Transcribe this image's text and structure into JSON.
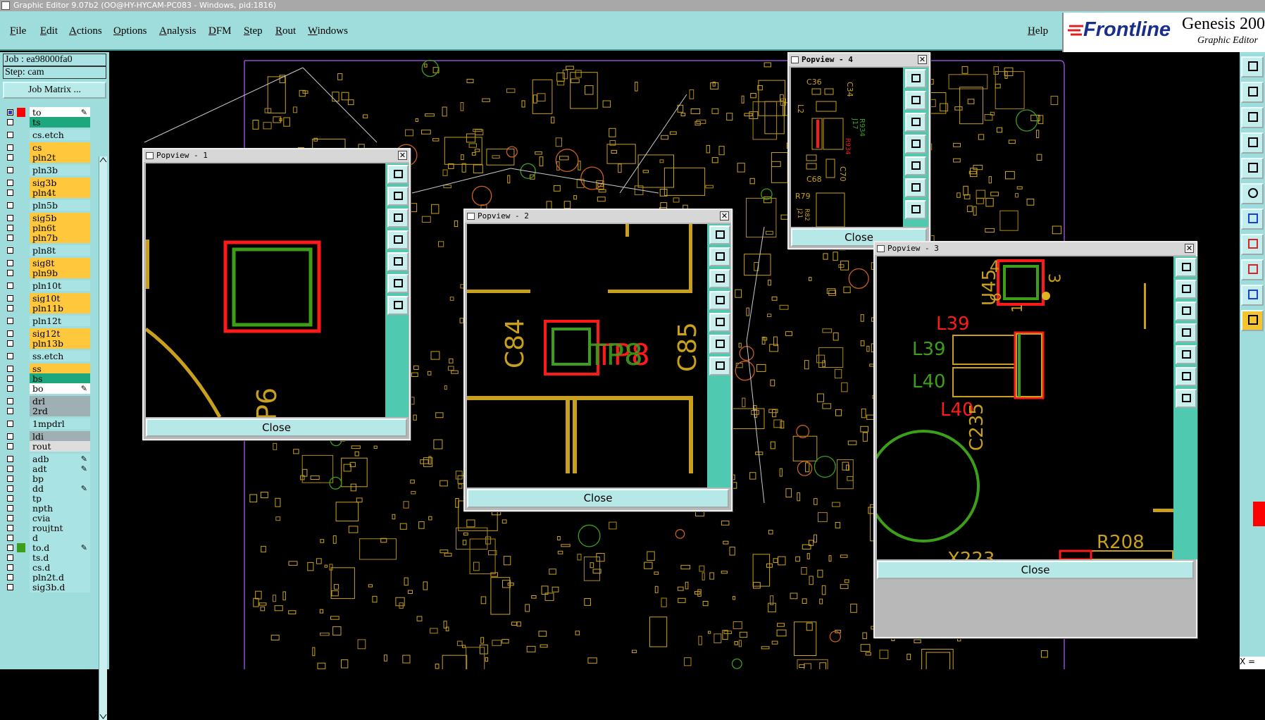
{
  "window": {
    "title": "Graphic Editor 9.07b2 (OO@HY-HYCAM-PC083 - Windows, pid:1816)"
  },
  "menu": {
    "items": [
      "File",
      "Edit",
      "Actions",
      "Options",
      "Analysis",
      "DFM",
      "Step",
      "Rout",
      "Windows"
    ],
    "help": "Help"
  },
  "brand": {
    "logo": "Frontline",
    "product": "Genesis 200",
    "subtitle": "Graphic Editor"
  },
  "job": {
    "job_label": "Job : ea98000fa0",
    "step_label": "Step: cam",
    "matrix_button": "Job Matrix ..."
  },
  "colors": {
    "cyan_ui": "#9fdcdc",
    "layer_yellow": "#ffc83c",
    "layer_teal": "#1ca87c",
    "layer_grey": "#9fb0b5",
    "copper": "#c8a01e",
    "green": "#3d9e1a",
    "red": "#ff1a1a"
  },
  "layers": [
    {
      "name": "to",
      "color": "#ffffff",
      "swatch": "#ff0000",
      "checked": true,
      "edit": true
    },
    {
      "name": "ts",
      "color": "#1ca87c",
      "swatch": "",
      "checked": false,
      "edit": false
    },
    {
      "name": "cs.etch",
      "color": "#a9e3e3",
      "swatch": "",
      "checked": false,
      "edit": false,
      "gap": true
    },
    {
      "name": "cs",
      "color": "#ffc83c",
      "swatch": "",
      "checked": false,
      "edit": false,
      "gap": true
    },
    {
      "name": "pln2t",
      "color": "#ffc83c",
      "swatch": "",
      "checked": false,
      "edit": false
    },
    {
      "name": "pln3b",
      "color": "#a9e3e3",
      "swatch": "",
      "checked": false,
      "edit": false,
      "gap": true
    },
    {
      "name": "sig3b",
      "color": "#ffc83c",
      "swatch": "",
      "checked": false,
      "edit": false,
      "gap": true
    },
    {
      "name": "pln4t",
      "color": "#ffc83c",
      "swatch": "",
      "checked": false,
      "edit": false
    },
    {
      "name": "pln5b",
      "color": "#a9e3e3",
      "swatch": "",
      "checked": false,
      "edit": false,
      "gap": true
    },
    {
      "name": "sig5b",
      "color": "#ffc83c",
      "swatch": "",
      "checked": false,
      "edit": false,
      "gap": true
    },
    {
      "name": "pln6t",
      "color": "#ffc83c",
      "swatch": "",
      "checked": false,
      "edit": false
    },
    {
      "name": "pln7b",
      "color": "#ffc83c",
      "swatch": "",
      "checked": false,
      "edit": false
    },
    {
      "name": "pln8t",
      "color": "#a9e3e3",
      "swatch": "",
      "checked": false,
      "edit": false,
      "gap": true
    },
    {
      "name": "sig8t",
      "color": "#ffc83c",
      "swatch": "",
      "checked": false,
      "edit": false,
      "gap": true
    },
    {
      "name": "pln9b",
      "color": "#ffc83c",
      "swatch": "",
      "checked": false,
      "edit": false
    },
    {
      "name": "pln10t",
      "color": "#a9e3e3",
      "swatch": "",
      "checked": false,
      "edit": false,
      "gap": true
    },
    {
      "name": "sig10t",
      "color": "#ffc83c",
      "swatch": "",
      "checked": false,
      "edit": false,
      "gap": true
    },
    {
      "name": "pln11b",
      "color": "#ffc83c",
      "swatch": "",
      "checked": false,
      "edit": false
    },
    {
      "name": "pln12t",
      "color": "#a9e3e3",
      "swatch": "",
      "checked": false,
      "edit": false,
      "gap": true
    },
    {
      "name": "sig12t",
      "color": "#ffc83c",
      "swatch": "",
      "checked": false,
      "edit": false,
      "gap": true
    },
    {
      "name": "pln13b",
      "color": "#ffc83c",
      "swatch": "",
      "checked": false,
      "edit": false
    },
    {
      "name": "ss.etch",
      "color": "#a9e3e3",
      "swatch": "",
      "checked": false,
      "edit": false,
      "gap": true
    },
    {
      "name": "ss",
      "color": "#ffc83c",
      "swatch": "",
      "checked": false,
      "edit": false,
      "gap": true
    },
    {
      "name": "bs",
      "color": "#1ca87c",
      "swatch": "",
      "checked": false,
      "edit": false
    },
    {
      "name": "bo",
      "color": "#ffffff",
      "swatch": "",
      "checked": false,
      "edit": true
    },
    {
      "name": "drl",
      "color": "#9fb0b5",
      "swatch": "",
      "checked": false,
      "edit": false,
      "gap": true
    },
    {
      "name": "2rd",
      "color": "#9fb0b5",
      "swatch": "",
      "checked": false,
      "edit": false
    },
    {
      "name": "1mpdrl",
      "color": "#a9e3e3",
      "swatch": "",
      "checked": false,
      "edit": false,
      "gap": true
    },
    {
      "name": "ldi",
      "color": "#9fb0b5",
      "swatch": "",
      "checked": false,
      "edit": false,
      "gap": true
    },
    {
      "name": "rout",
      "color": "#dddddd",
      "swatch": "",
      "checked": false,
      "edit": false
    },
    {
      "name": "adb",
      "color": "#a9e3e3",
      "swatch": "",
      "checked": false,
      "edit": true,
      "gap": true
    },
    {
      "name": "adt",
      "color": "#a9e3e3",
      "swatch": "",
      "checked": false,
      "edit": true
    },
    {
      "name": "bp",
      "color": "#a9e3e3",
      "swatch": "",
      "checked": false,
      "edit": false
    },
    {
      "name": "dd",
      "color": "#a9e3e3",
      "swatch": "",
      "checked": false,
      "edit": true
    },
    {
      "name": "tp",
      "color": "#a9e3e3",
      "swatch": "",
      "checked": false,
      "edit": false
    },
    {
      "name": "npth",
      "color": "#a9e3e3",
      "swatch": "",
      "checked": false,
      "edit": false
    },
    {
      "name": "cvia",
      "color": "#a9e3e3",
      "swatch": "",
      "checked": false,
      "edit": false
    },
    {
      "name": "roujtnt",
      "color": "#a9e3e3",
      "swatch": "",
      "checked": false,
      "edit": false
    },
    {
      "name": "d",
      "color": "#a9e3e3",
      "swatch": "",
      "checked": false,
      "edit": false
    },
    {
      "name": "to.d",
      "color": "#a9e3e3",
      "swatch": "#3d9e1a",
      "checked": false,
      "edit": true
    },
    {
      "name": "ts.d",
      "color": "#a9e3e3",
      "swatch": "",
      "checked": false,
      "edit": false
    },
    {
      "name": "cs.d",
      "color": "#a9e3e3",
      "swatch": "",
      "checked": false,
      "edit": false
    },
    {
      "name": "pln2t.d",
      "color": "#a9e3e3",
      "swatch": "",
      "checked": false,
      "edit": false
    },
    {
      "name": "sig3b.d",
      "color": "#a9e3e3",
      "swatch": "",
      "checked": false,
      "edit": false
    }
  ],
  "popviews": {
    "p1": {
      "title": "Popview - 1",
      "close": "Close",
      "labels": [
        "P6"
      ]
    },
    "p2": {
      "title": "Popview - 2",
      "close": "Close",
      "labels": [
        "C84",
        "C85",
        "TP8",
        "TP8"
      ]
    },
    "p3": {
      "title": "Popview - 3",
      "close": "Close",
      "labels": [
        "U45",
        "4",
        "3",
        "6",
        "1",
        "L39",
        "L39",
        "L40",
        "L40",
        "C235",
        "R208",
        "X223"
      ]
    },
    "p4": {
      "title": "Popview - 4",
      "close": "Close",
      "labels": [
        "C36",
        "C34",
        "L2",
        "J17",
        "R934",
        "R934",
        "C68",
        "C70",
        "R79",
        "J21",
        "R82"
      ]
    }
  },
  "status": {
    "coord_label": "X ="
  }
}
